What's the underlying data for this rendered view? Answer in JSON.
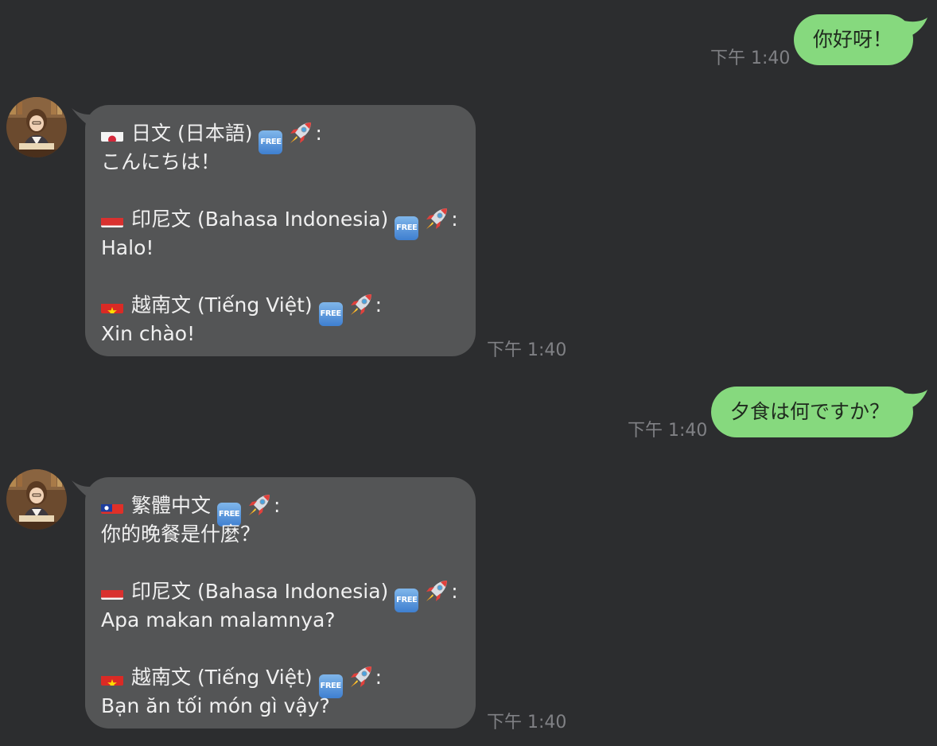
{
  "messages": [
    {
      "side": "out",
      "text": "你好呀！",
      "time": "下午 1:40"
    },
    {
      "side": "in",
      "time": "下午 1:40",
      "blocks": [
        {
          "flag": "japan-flag-icon",
          "language": "日文 (日本語)",
          "colon": ":",
          "text": "こんにちは！"
        },
        {
          "flag": "indonesia-flag-icon",
          "language": "印尼文 (Bahasa Indonesia)",
          "colon": ":",
          "text": "Halo!"
        },
        {
          "flag": "vietnam-flag-icon",
          "language": "越南文 (Tiếng Việt)",
          "colon": ":",
          "text": "Xin chào!"
        }
      ]
    },
    {
      "side": "out",
      "text": "夕食は何ですか？",
      "time": "下午 1:40"
    },
    {
      "side": "in",
      "time": "下午 1:40",
      "blocks": [
        {
          "flag": "taiwan-flag-icon",
          "language": "繁體中文",
          "colon": ":",
          "text": "你的晚餐是什麼？"
        },
        {
          "flag": "indonesia-flag-icon",
          "language": "印尼文 (Bahasa Indonesia)",
          "colon": ":",
          "text": "Apa makan malamnya?"
        },
        {
          "flag": "vietnam-flag-icon",
          "language": "越南文 (Tiếng Việt)",
          "colon": ":",
          "text": "Bạn ăn tối món gì vậy?"
        }
      ]
    }
  ],
  "badges": {
    "free_label": "FREE",
    "free_icon": "free-badge-icon",
    "rocket_icon": "rocket-icon"
  },
  "colors": {
    "background": "#2c2d2f",
    "outgoing_bubble": "#86d97e",
    "incoming_bubble": "#545556",
    "timestamp": "#808185"
  }
}
